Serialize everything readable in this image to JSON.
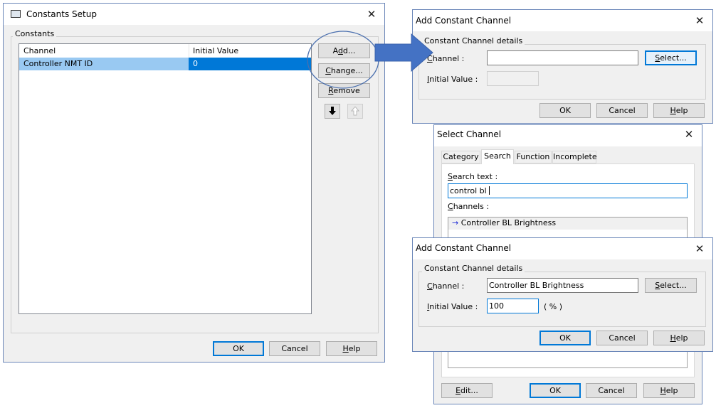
{
  "constants_setup": {
    "title": "Constants Setup",
    "group_label": "Constants",
    "columns": [
      "Channel",
      "Initial Value"
    ],
    "rows": [
      {
        "channel": "Controller NMT ID",
        "value": "0"
      }
    ],
    "add_prefix": "A",
    "add_underlined": "d",
    "add_suffix": "d...",
    "change_prefix": "",
    "change_underlined": "C",
    "change_suffix": "hange...",
    "remove_prefix": "",
    "remove_underlined": "R",
    "remove_suffix": "emove",
    "ok": "OK",
    "cancel": "Cancel",
    "help_prefix": "",
    "help_underlined": "H",
    "help_suffix": "elp",
    "down_icon": "arrow-down-icon",
    "up_icon": "arrow-up-icon"
  },
  "add_channel_empty": {
    "title": "Add Constant Channel",
    "group_label": "Constant Channel details",
    "channel_underlined": "C",
    "channel_suffix": "hannel :",
    "initial_underlined": "I",
    "initial_suffix": "nitial Value :",
    "channel_value": "",
    "select_prefix": "",
    "select_underlined": "S",
    "select_suffix": "elect...",
    "ok": "OK",
    "cancel": "Cancel",
    "help_prefix": "",
    "help_underlined": "H",
    "help_suffix": "elp"
  },
  "select_channel": {
    "title": "Select Channel",
    "tabs": [
      "Category",
      "Search",
      "Function",
      "Incomplete"
    ],
    "active_tab": "Search",
    "search_underlined": "S",
    "search_suffix": "earch text :",
    "search_value": "control bl",
    "channels_underlined": "C",
    "channels_suffix": "hannels :",
    "results": [
      "Controller BL Brightness"
    ],
    "edit_prefix": "",
    "edit_underlined": "E",
    "edit_suffix": "dit...",
    "ok": "OK",
    "cancel": "Cancel",
    "help_prefix": "",
    "help_underlined": "H",
    "help_suffix": "elp"
  },
  "add_channel_filled": {
    "title": "Add Constant Channel",
    "group_label": "Constant Channel details",
    "channel_underlined": "C",
    "channel_suffix": "hannel :",
    "initial_underlined": "I",
    "initial_suffix": "nitial Value :",
    "channel_value": "Controller BL Brightness",
    "initial_value": "100",
    "unit": "( % )",
    "select_prefix": "",
    "select_underlined": "S",
    "select_suffix": "elect...",
    "ok": "OK",
    "cancel": "Cancel",
    "help_prefix": "",
    "help_underlined": "H",
    "help_suffix": "elp"
  },
  "colors": {
    "selection": "#0078d7",
    "selection_light": "#99c9f2",
    "arrow": "#4472c4",
    "focus": "#0078d7"
  }
}
